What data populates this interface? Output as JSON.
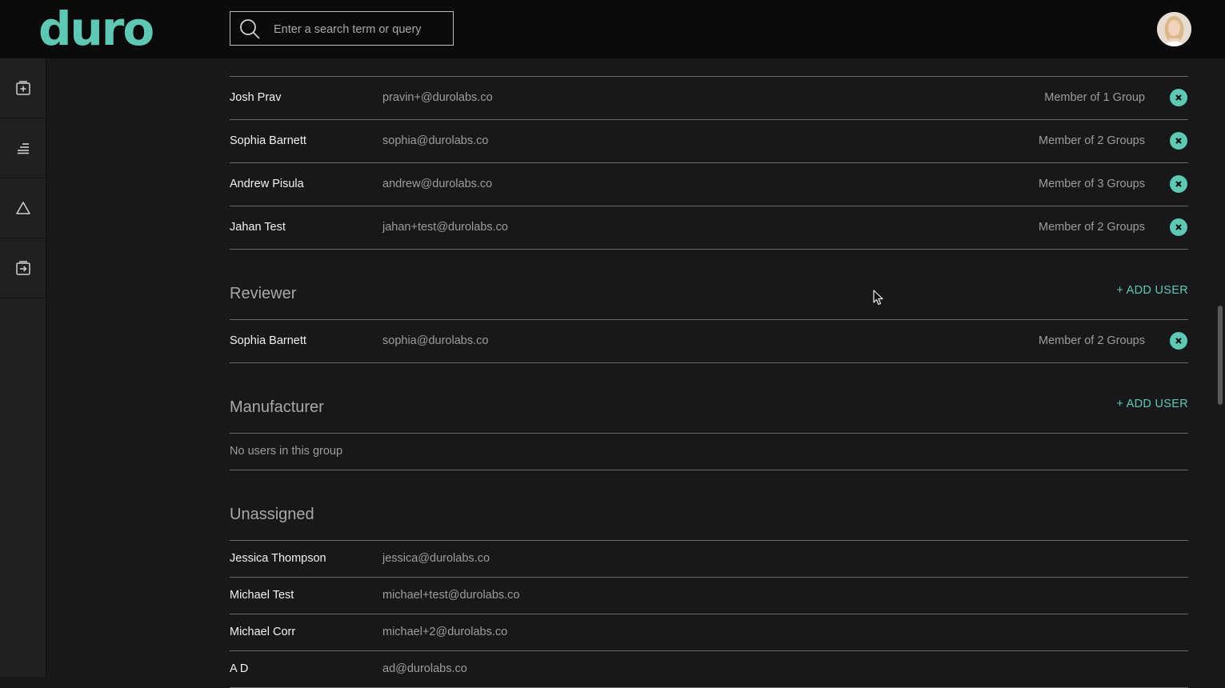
{
  "app": {
    "logo": "duro"
  },
  "search": {
    "placeholder": "Enter a search term or query"
  },
  "sidebar": {
    "items": [
      {
        "icon": "library-add-icon"
      },
      {
        "icon": "list-icon"
      },
      {
        "icon": "warning-icon"
      },
      {
        "icon": "import-icon"
      }
    ]
  },
  "groups": {
    "top_rows": [
      {
        "name": "Josh Prav",
        "email": "pravin+@durolabs.co",
        "groups": "Member of 1 Group"
      },
      {
        "name": "Sophia Barnett",
        "email": "sophia@durolabs.co",
        "groups": "Member of 2 Groups"
      },
      {
        "name": "Andrew Pisula",
        "email": "andrew@durolabs.co",
        "groups": "Member of 3 Groups"
      },
      {
        "name": "Jahan Test",
        "email": "jahan+test@durolabs.co",
        "groups": "Member of 2 Groups"
      }
    ],
    "reviewer": {
      "title": "Reviewer",
      "add_label": "+ ADD USER",
      "rows": [
        {
          "name": "Sophia Barnett",
          "email": "sophia@durolabs.co",
          "groups": "Member of 2 Groups"
        }
      ]
    },
    "manufacturer": {
      "title": "Manufacturer",
      "add_label": "+ ADD USER",
      "empty_text": "No users in this group"
    },
    "unassigned": {
      "title": "Unassigned",
      "rows": [
        {
          "name": "Jessica Thompson",
          "email": "jessica@durolabs.co"
        },
        {
          "name": "Michael Test",
          "email": "michael+test@durolabs.co"
        },
        {
          "name": "Michael Corr",
          "email": "michael+2@durolabs.co"
        },
        {
          "name": "A D",
          "email": "ad@durolabs.co"
        }
      ]
    }
  },
  "colors": {
    "accent": "#5ec8b4",
    "background": "#18181b",
    "topbar": "#0b0b0c"
  }
}
